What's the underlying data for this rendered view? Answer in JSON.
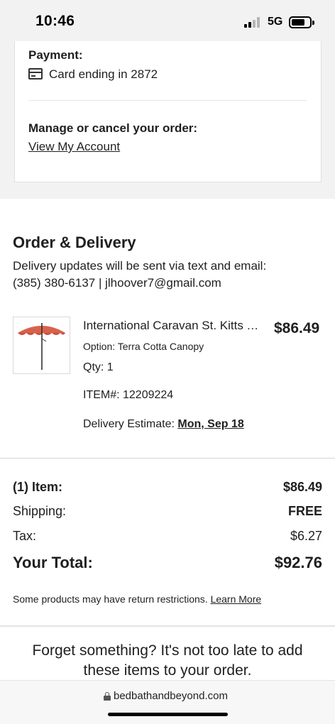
{
  "status_bar": {
    "time": "10:46",
    "network": "5G",
    "icons": [
      "signal-icon",
      "battery-icon"
    ]
  },
  "payment": {
    "title": "Payment:",
    "card_icon": "credit-card-icon",
    "card_text": "Card ending in 2872"
  },
  "manage": {
    "title": "Manage or cancel your order:",
    "link": "View My Account"
  },
  "order_delivery": {
    "title": "Order & Delivery",
    "updates": "Delivery updates will be sent via text and email:",
    "contact": "(385) 380-6137 | jlhoover7@gmail.com"
  },
  "product": {
    "image_icon": "patio-umbrella-image",
    "name": "International Caravan St. Kitts Terra Cotta Canopy Umbrella",
    "price": "$86.49",
    "option": "Option: Terra Cotta Canopy",
    "qty": "Qty: 1",
    "item_number": "ITEM#: 12209224",
    "delivery_label": "Delivery Estimate:",
    "delivery_date": "Mon, Sep 18",
    "canopy_color": "#d9614b"
  },
  "totals": {
    "items_label": "(1) Item:",
    "items_value": "$86.49",
    "shipping_label": "Shipping:",
    "shipping_value": "FREE",
    "tax_label": "Tax:",
    "tax_value": "$6.27",
    "total_label": "Your Total:",
    "total_value": "$92.76"
  },
  "restrictions": {
    "text": "Some products may have return restrictions.",
    "link": "Learn More"
  },
  "forget": {
    "line1": "Forget something? It's not too late to add",
    "line2": "these items to your order."
  },
  "browser": {
    "url": "bedbathandbeyond.com",
    "lock_icon": "lock-icon"
  }
}
